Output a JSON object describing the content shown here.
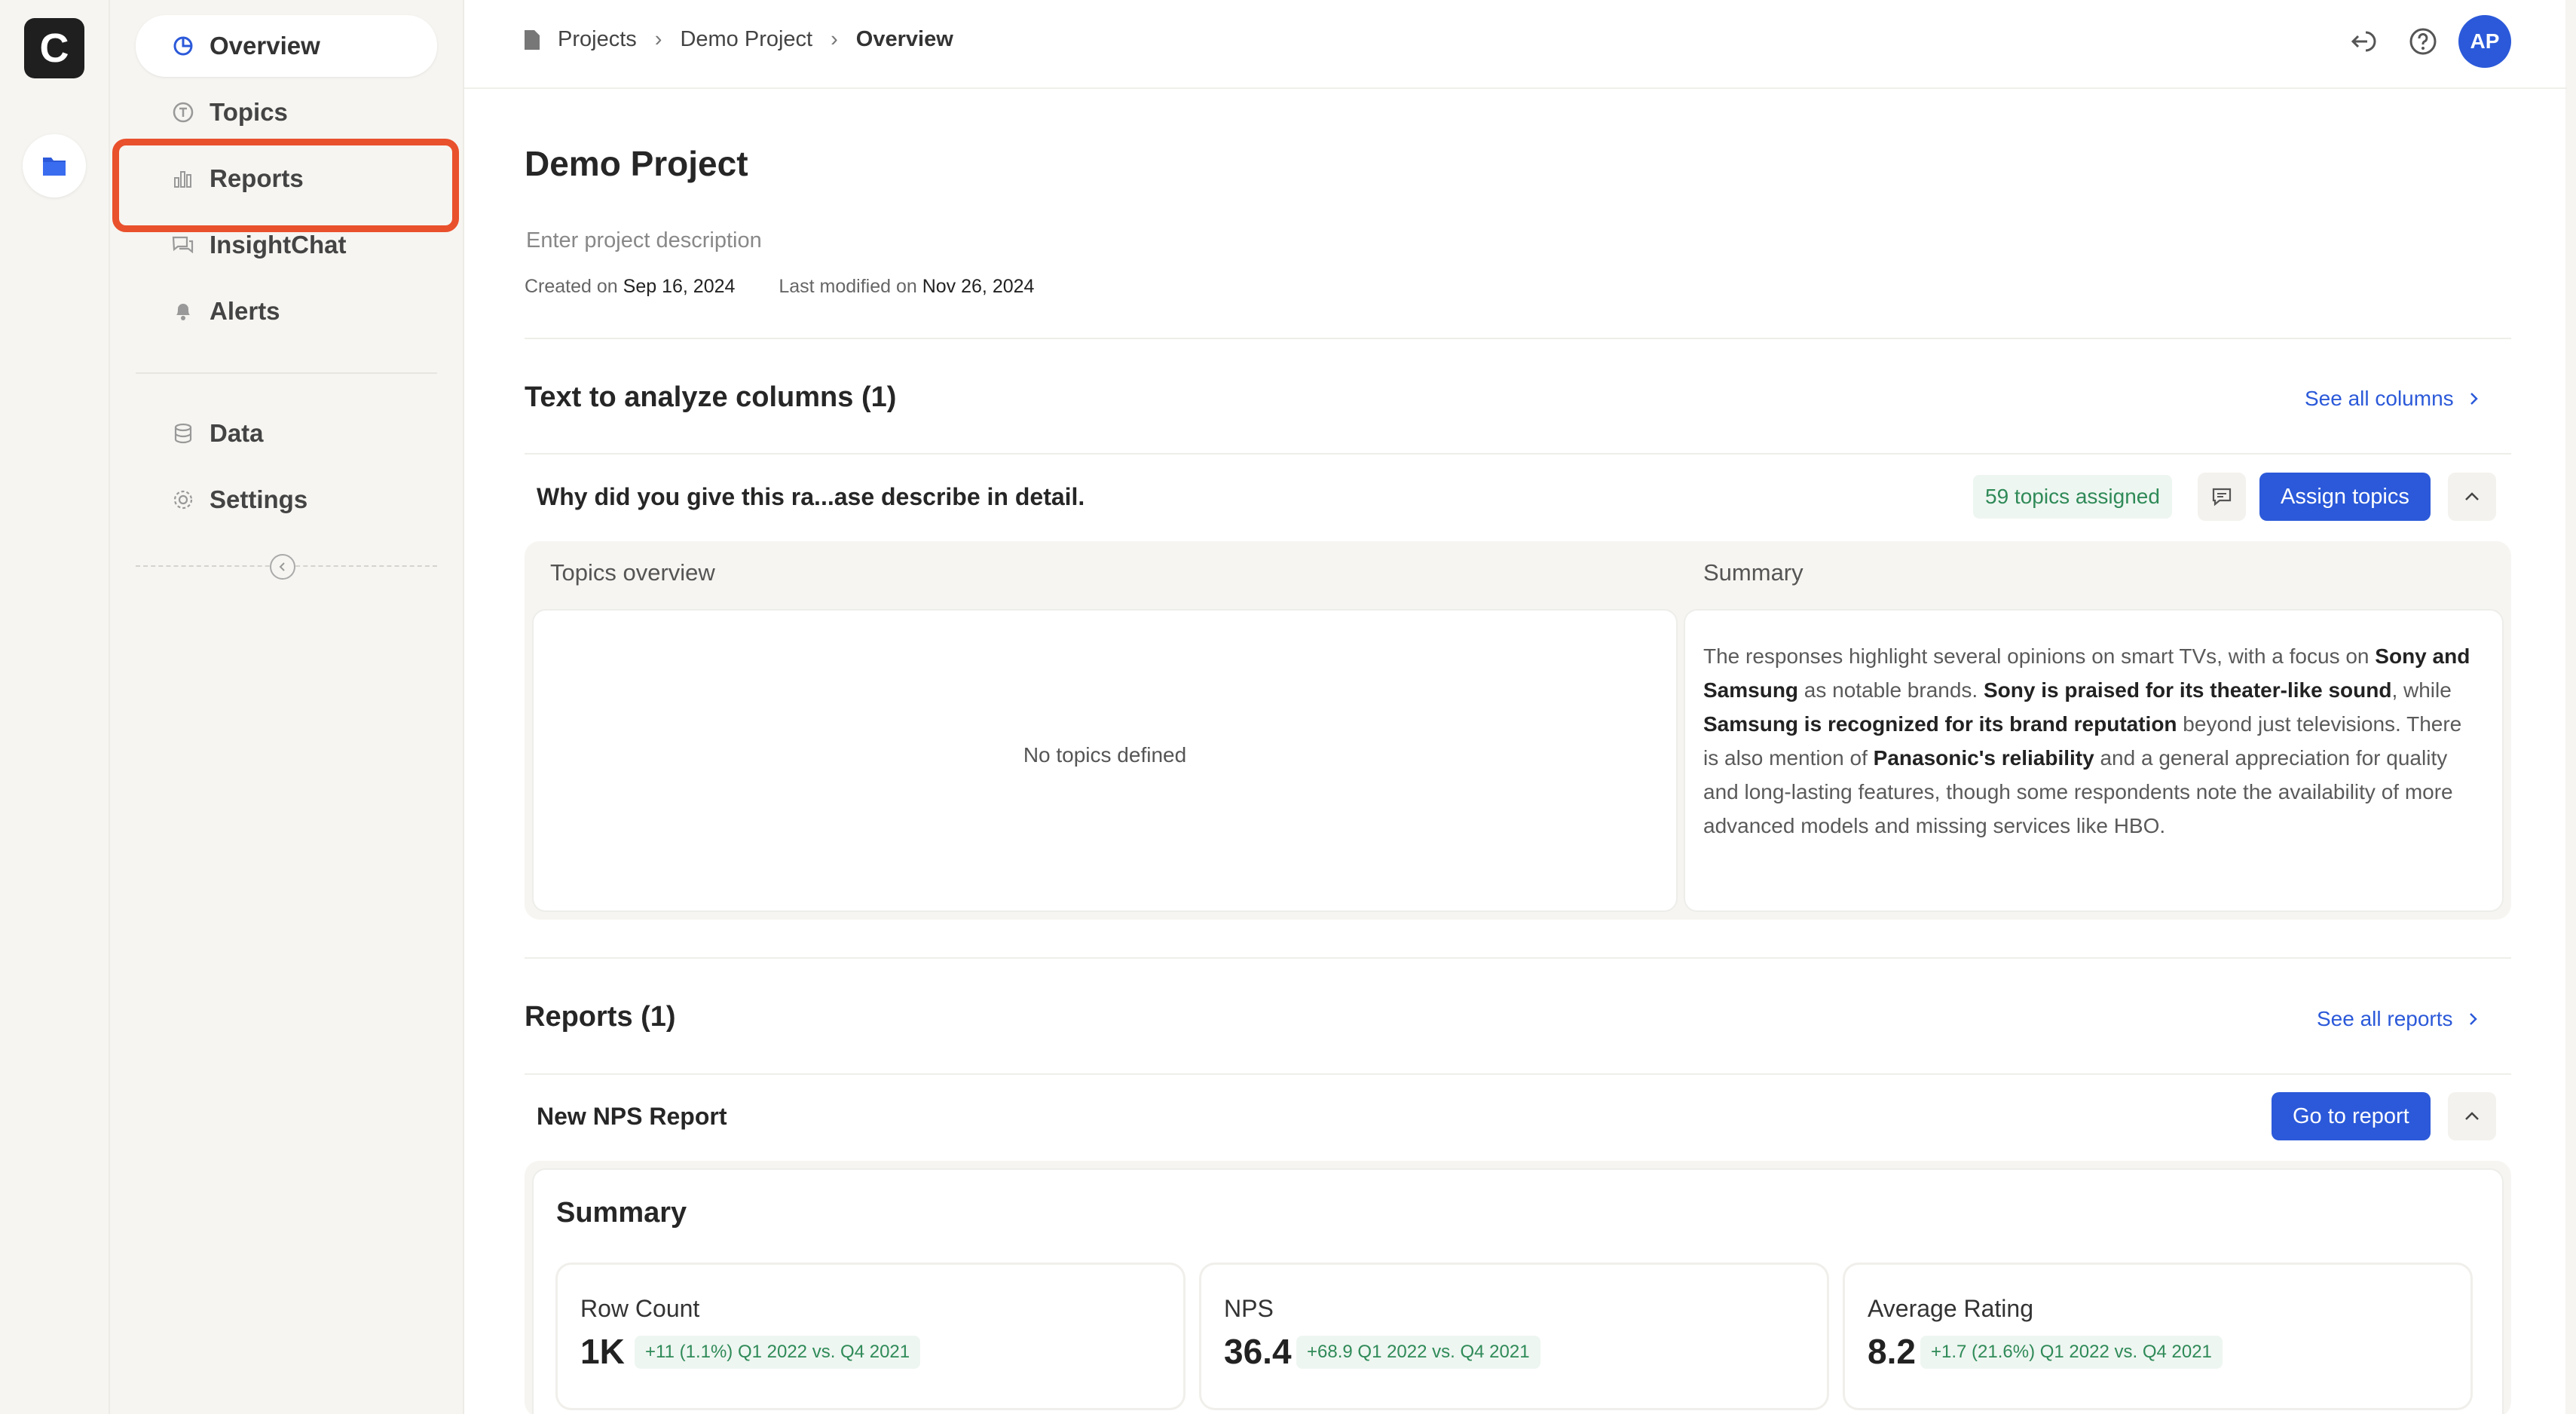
{
  "app": {
    "logo_letter": "C"
  },
  "sidebar": {
    "items": [
      {
        "label": "Overview",
        "icon": "pie-chart-icon"
      },
      {
        "label": "Topics",
        "icon": "topic-icon"
      },
      {
        "label": "Reports",
        "icon": "bar-chart-icon"
      },
      {
        "label": "InsightChat",
        "icon": "chat-icon"
      },
      {
        "label": "Alerts",
        "icon": "bell-icon"
      },
      {
        "label": "Data",
        "icon": "database-icon"
      },
      {
        "label": "Settings",
        "icon": "gear-icon"
      }
    ]
  },
  "breadcrumb": {
    "items": [
      "Projects",
      "Demo Project",
      "Overview"
    ]
  },
  "user": {
    "initials": "AP"
  },
  "project": {
    "title": "Demo Project",
    "description_placeholder": "Enter project description",
    "created_label": "Created on",
    "created_date": "Sep 16, 2024",
    "modified_label": "Last modified on",
    "modified_date": "Nov 26, 2024"
  },
  "columns_section": {
    "title": "Text to analyze columns (1)",
    "see_all": "See all columns",
    "column": {
      "name": "Why did you give this ra...ase describe in detail.",
      "topics_badge": "59 topics assigned",
      "assign_button": "Assign topics",
      "topics_overview_label": "Topics overview",
      "summary_label": "Summary",
      "empty_text": "No topics defined",
      "summary_parts": [
        {
          "t": "The responses highlight several opinions on smart TVs, with a focus on ",
          "b": false
        },
        {
          "t": "Sony and Samsung",
          "b": true
        },
        {
          "t": " as notable brands. ",
          "b": false
        },
        {
          "t": "Sony is praised for its theater-like sound",
          "b": true
        },
        {
          "t": ", while ",
          "b": false
        },
        {
          "t": "Samsung is recognized for its brand reputation",
          "b": true
        },
        {
          "t": " beyond just televisions. There is also mention of ",
          "b": false
        },
        {
          "t": "Panasonic's reliability",
          "b": true
        },
        {
          "t": " and a general appreciation for quality and long-lasting features, though some respondents note the availability of more advanced models and missing services like HBO.",
          "b": false
        }
      ]
    }
  },
  "reports_section": {
    "title": "Reports (1)",
    "see_all": "See all reports",
    "report": {
      "name": "New NPS Report",
      "go_button": "Go to report",
      "summary_title": "Summary",
      "kpis": [
        {
          "label": "Row Count",
          "value": "1K",
          "delta": "+11 (1.1%) Q1 2022 vs. Q4 2021"
        },
        {
          "label": "NPS",
          "value": "36.4",
          "delta": "+68.9 Q1 2022 vs. Q4 2021"
        },
        {
          "label": "Average Rating",
          "value": "8.2",
          "delta": "+1.7 (21.6%) Q1 2022 vs. Q4 2021"
        }
      ]
    }
  },
  "colors": {
    "accent": "#2b59d9",
    "highlight": "#e9502c",
    "positive": "#2f8a58"
  }
}
